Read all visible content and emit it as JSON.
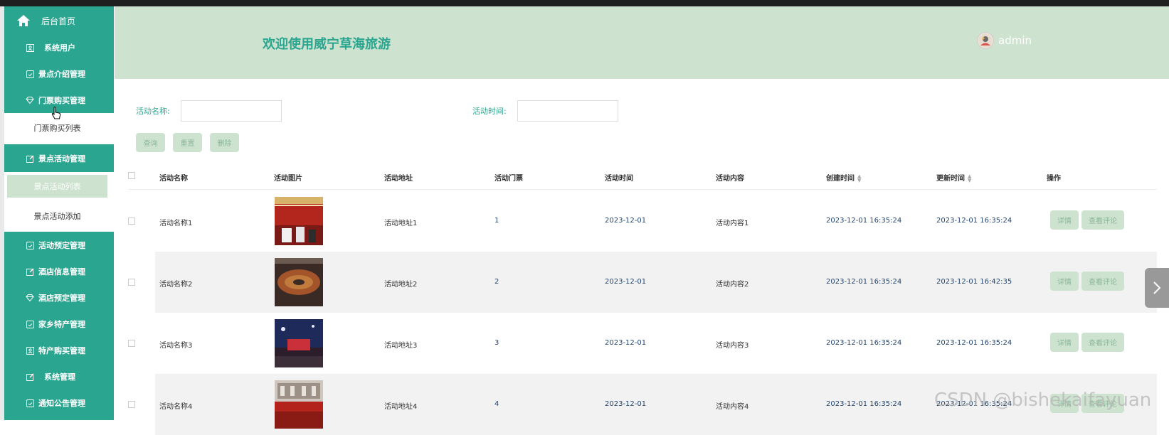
{
  "sidebar": {
    "home_label": "后台首页",
    "items": [
      {
        "label": "系统用户",
        "icon": "user-card-icon"
      },
      {
        "label": "景点介绍管理",
        "icon": "card-icon"
      },
      {
        "label": "门票购买管理",
        "icon": "diamond-icon"
      },
      {
        "label": "景点活动管理",
        "icon": "edit-icon"
      },
      {
        "label": "活动预定管理",
        "icon": "card-icon"
      },
      {
        "label": "酒店信息管理",
        "icon": "edit-icon"
      },
      {
        "label": "酒店预定管理",
        "icon": "diamond-icon"
      },
      {
        "label": "家乡特产管理",
        "icon": "card-icon"
      },
      {
        "label": "特产购买管理",
        "icon": "user-card-icon"
      },
      {
        "label": "系统管理",
        "icon": "edit-icon"
      },
      {
        "label": "通知公告管理",
        "icon": "card-icon"
      }
    ],
    "ticket_sub": "门票购买列表",
    "activity_subs": [
      "景点活动列表",
      "景点活动添加"
    ]
  },
  "header": {
    "welcome": "欢迎使用威宁草海旅游",
    "username": "admin"
  },
  "search": {
    "name_label": "活动名称:",
    "time_label": "活动时间:",
    "name_value": "",
    "time_value": ""
  },
  "buttons": {
    "query": "查询",
    "reset": "重置",
    "delete": "删除"
  },
  "table": {
    "headers": [
      "活动名称",
      "活动图片",
      "活动地址",
      "活动门票",
      "活动时间",
      "活动内容",
      "创建时间",
      "更新时间",
      "操作"
    ],
    "rows": [
      {
        "name": "活动名称1",
        "address": "活动地址1",
        "ticket": "1",
        "time": "2023-12-01",
        "content": "活动内容1",
        "created": "2023-12-01 16:35:24",
        "updated": "2023-12-01 16:35:24"
      },
      {
        "name": "活动名称2",
        "address": "活动地址2",
        "ticket": "2",
        "time": "2023-12-01",
        "content": "活动内容2",
        "created": "2023-12-01 16:35:24",
        "updated": "2023-12-01 16:42:35"
      },
      {
        "name": "活动名称3",
        "address": "活动地址3",
        "ticket": "3",
        "time": "2023-12-01",
        "content": "活动内容3",
        "created": "2023-12-01 16:35:24",
        "updated": "2023-12-01 16:35:24"
      },
      {
        "name": "活动名称4",
        "address": "活动地址4",
        "ticket": "4",
        "time": "2023-12-01",
        "content": "活动内容4",
        "created": "2023-12-01 16:35:24",
        "updated": "2023-12-01 16:35:24"
      }
    ],
    "detail_label": "详情",
    "comment_label": "查看评论"
  },
  "watermark": "CSDN @bishekaifayuan",
  "colors": {
    "primary": "#2aa58f",
    "header_bg": "#cde3cf",
    "button_bg": "#cde3cf"
  }
}
